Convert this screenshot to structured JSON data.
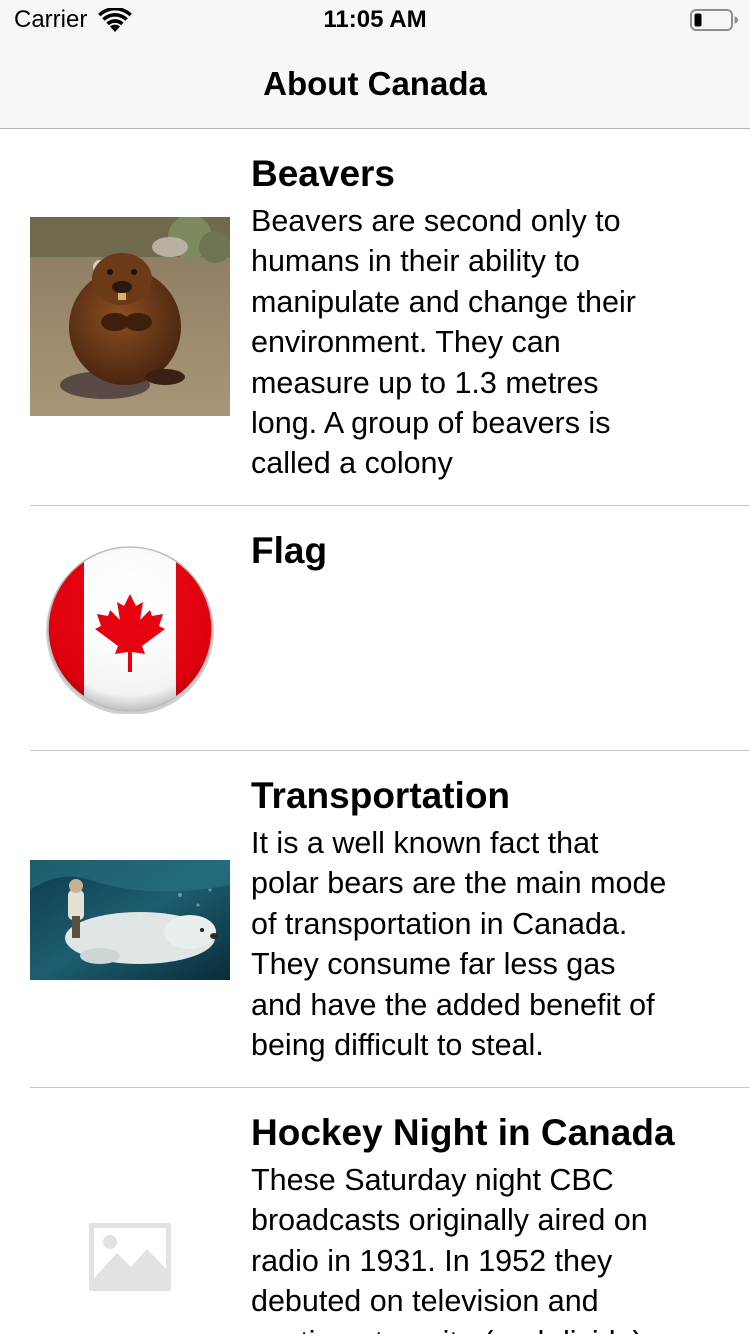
{
  "status_bar": {
    "carrier": "Carrier",
    "time": "11:05 AM",
    "wifi_icon": "wifi-icon",
    "battery_icon": "battery-icon"
  },
  "nav": {
    "title": "About Canada"
  },
  "rows": [
    {
      "title": "Beavers",
      "description": "Beavers are second only to\nhumans in their ability to\nmanipulate and change their\nenvironment. They can\nmeasure up to 1.3 metres\nlong. A group of beavers is\ncalled a colony",
      "image": "beaver-photo"
    },
    {
      "title": "Flag",
      "description": "",
      "image": "canada-flag-icon"
    },
    {
      "title": "Transportation",
      "description": "It is a well known fact that\npolar bears are the main mode\nof transportation in Canada.\nThey consume far less gas\nand have the added benefit of\nbeing difficult to steal.",
      "image": "polar-bear-rider-photo"
    },
    {
      "title": "Hockey Night in Canada",
      "description": "These Saturday night CBC\nbroadcasts originally aired on\nradio in 1931. In 1952 they\ndebuted on television and\ncontinue to unite (and divide)",
      "image": "image-placeholder-icon"
    }
  ],
  "colors": {
    "bar_background": "#f7f7f7",
    "separator": "#c8c7cc",
    "flag_red": "#e8000d",
    "placeholder_gray": "#e2e2e2"
  }
}
